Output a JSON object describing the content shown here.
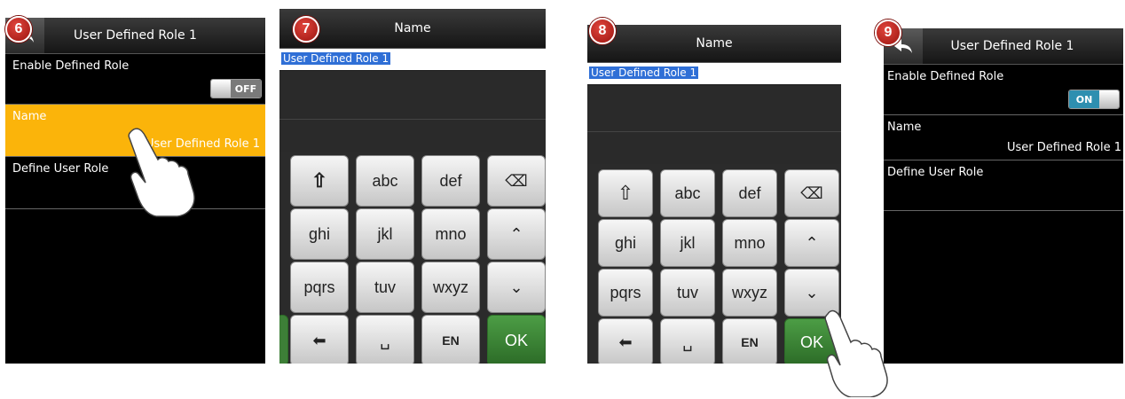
{
  "badges": [
    "6",
    "7",
    "8",
    "9"
  ],
  "screen6": {
    "title": "User Defined Role 1",
    "enable_label": "Enable Defined Role",
    "toggle_text": "OFF",
    "name_label": "Name",
    "name_value": "User Defined Role 1",
    "define_label": "Define User Role"
  },
  "screen7": {
    "title": "Name",
    "input_text": "User Defined Role 1"
  },
  "screen8": {
    "title": "Name",
    "input_text": "User Defined Role 1"
  },
  "screen9": {
    "title": "User Defined Role 1",
    "enable_label": "Enable Defined Role",
    "toggle_text": "ON",
    "name_label": "Name",
    "name_value": "User Defined Role 1",
    "define_label": "Define User Role"
  },
  "keyboard": {
    "row1": [
      "⇧",
      "abc",
      "def",
      "⌫"
    ],
    "row2": [
      "ghi",
      "jkl",
      "mno",
      "⌃"
    ],
    "row3": [
      "pqrs",
      "tuv",
      "wxyz",
      "⌄"
    ],
    "row4": [
      "⬅",
      "␣",
      "EN",
      "OK"
    ]
  },
  "colors": {
    "selected_row": "#fbb40a",
    "ok_key": "#3d7f37",
    "toggle_on": "#2e8fb0"
  }
}
